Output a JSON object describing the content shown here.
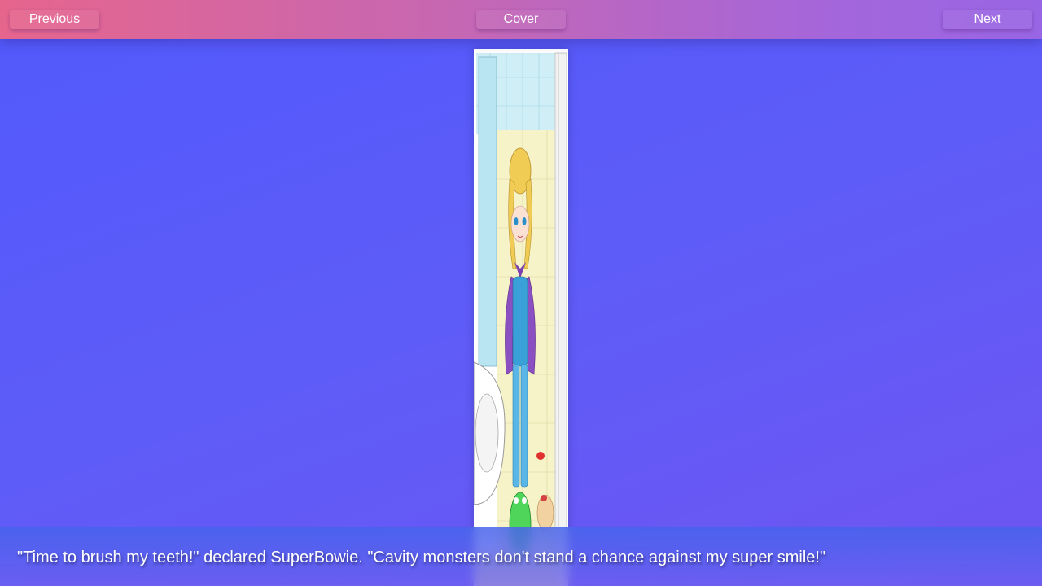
{
  "nav": {
    "previous_label": "Previous",
    "cover_label": "Cover",
    "next_label": "Next"
  },
  "page": {
    "illustration": "superbowie-bathroom-illustration"
  },
  "caption": {
    "text": "\"Time to brush my teeth!\" declared SuperBowie. \"Cavity monsters don't stand a chance against my super smile!\""
  },
  "colors": {
    "background_start": "#5259fb",
    "background_end": "#6e55f2",
    "topbar_start": "#e6658d",
    "topbar_end": "#9865e4"
  }
}
